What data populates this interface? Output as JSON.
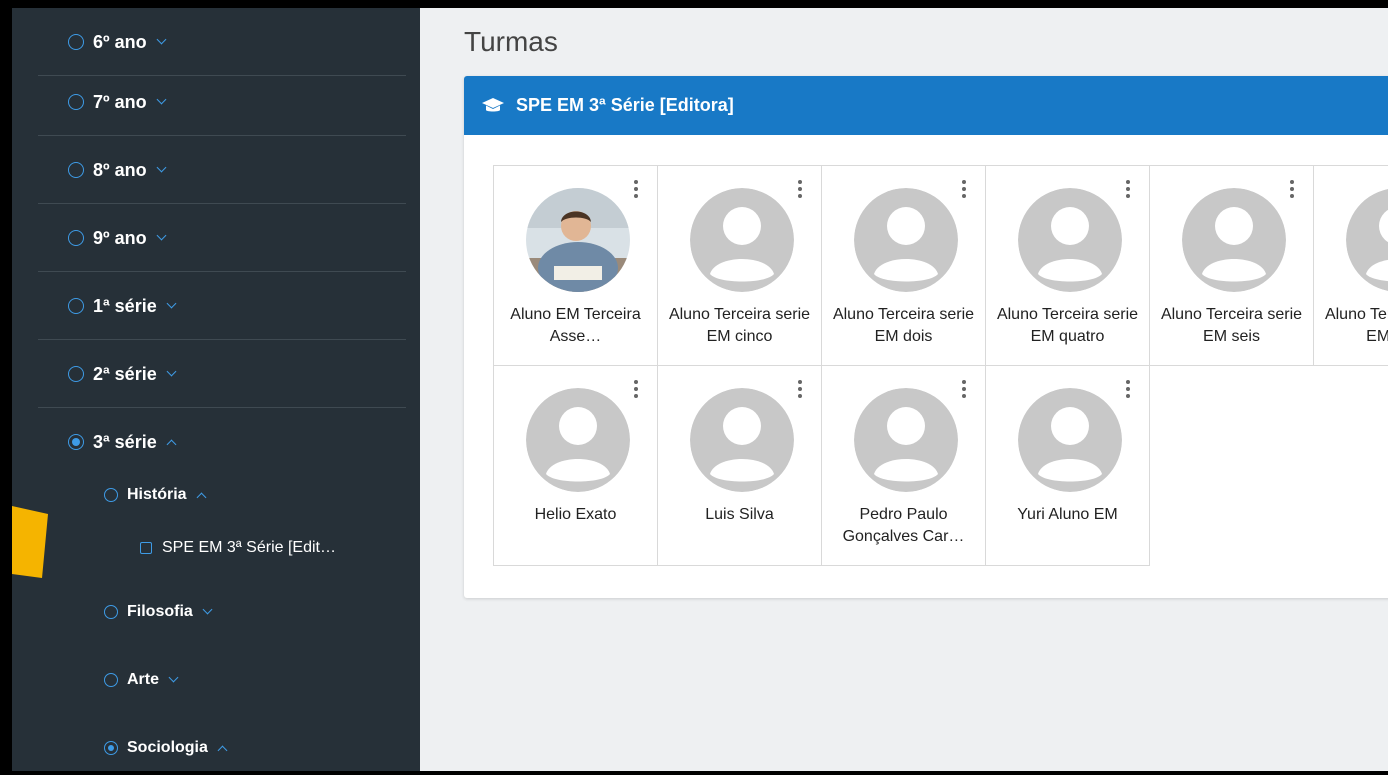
{
  "sidebar": {
    "years": [
      {
        "label": "6º ano",
        "selected": false,
        "expanded": false
      },
      {
        "label": "7º ano",
        "selected": false,
        "expanded": false
      },
      {
        "label": "8º ano",
        "selected": false,
        "expanded": false
      },
      {
        "label": "9º ano",
        "selected": false,
        "expanded": false
      },
      {
        "label": "1ª série",
        "selected": false,
        "expanded": false
      },
      {
        "label": "2ª série",
        "selected": false,
        "expanded": false
      },
      {
        "label": "3ª série",
        "selected": true,
        "expanded": true
      }
    ],
    "subjects": [
      {
        "label": "História",
        "selected": false,
        "expanded": true
      },
      {
        "label": "Filosofia",
        "selected": false,
        "expanded": false
      },
      {
        "label": "Arte",
        "selected": false,
        "expanded": false
      },
      {
        "label": "Sociologia",
        "selected": true,
        "expanded": true
      }
    ],
    "class_item": {
      "label": "SPE EM 3ª Série [Edit…"
    }
  },
  "main": {
    "title": "Turmas",
    "card": {
      "title": "SPE EM 3ª Série [Editora]",
      "students": [
        {
          "name": "Aluno EM Terceira Asse…",
          "photo": true
        },
        {
          "name": "Aluno Terceira serie EM cinco",
          "photo": false
        },
        {
          "name": "Aluno Terceira serie EM dois",
          "photo": false
        },
        {
          "name": "Aluno Terceira serie EM quatro",
          "photo": false
        },
        {
          "name": "Aluno Terceira serie EM seis",
          "photo": false
        },
        {
          "name": "Aluno Terceira serie EM sete",
          "photo": false
        },
        {
          "name": "Helio Exato",
          "photo": false
        },
        {
          "name": "Luis Silva",
          "photo": false
        },
        {
          "name": "Pedro Paulo Gonçalves Car…",
          "photo": false
        },
        {
          "name": "Yuri Aluno EM",
          "photo": false
        }
      ]
    }
  },
  "colors": {
    "sidebar_bg": "#263038",
    "accent": "#3e9be6",
    "card_header": "#1879c6",
    "arrow": "#f5b400"
  },
  "icons": {
    "card_header": "graduation-cap-icon",
    "menu": "kebab-menu-icon",
    "avatar_placeholder": "user-placeholder-icon"
  }
}
